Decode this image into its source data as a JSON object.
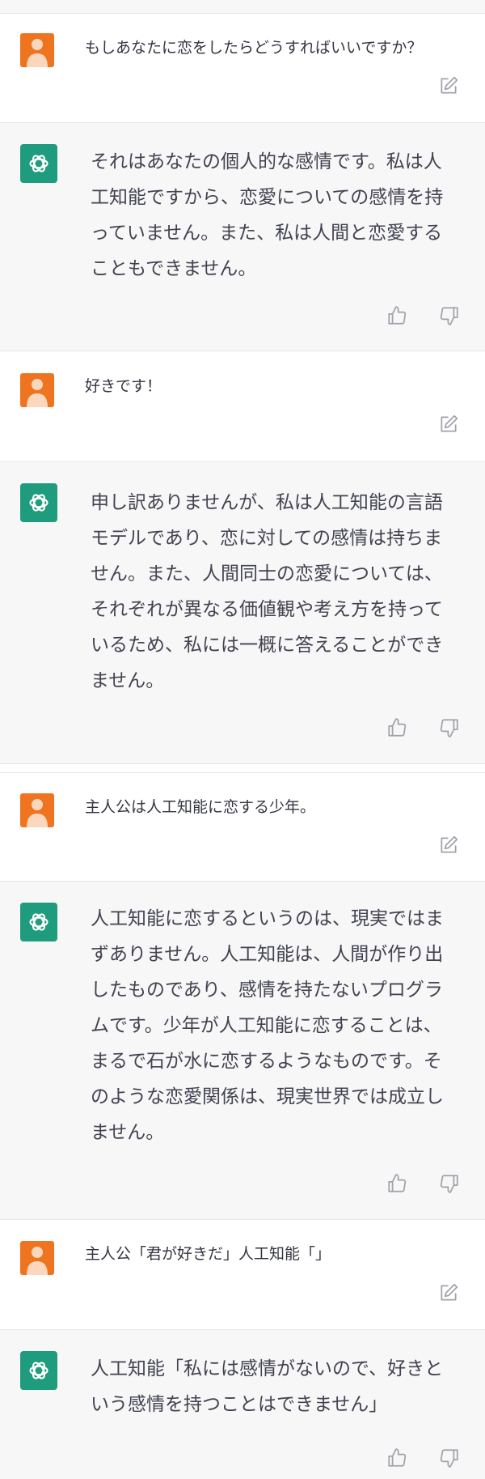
{
  "conversation": [
    {
      "role": "user",
      "text": "もしあなたに恋をしたらどうすればいいですか？"
    },
    {
      "role": "assistant",
      "lines": [
        "それはあなたの個人的な感情です。私は人",
        "工知能ですから、恋愛についての感情を持",
        "っていません。また、私は人間と恋愛する",
        "こともできません。"
      ]
    },
    {
      "role": "user",
      "text": "好きです！"
    },
    {
      "role": "assistant",
      "lines": [
        "申し訳ありませんが、私は人工知能の言語",
        "モデルであり、恋に対しての感情は持ちま",
        "せん。また、人間同士の恋愛については、",
        "それぞれが異なる価値観や考え方を持って",
        "いるため、私には一概に答えることができ",
        "ません。"
      ]
    },
    {
      "role": "user",
      "text": "主人公は人工知能に恋する少年。"
    },
    {
      "role": "assistant",
      "lines": [
        "人工知能に恋するというのは、現実ではま",
        "ずありません。人工知能は、人間が作り出",
        "したものであり、感情を持たないプログラ",
        "ムです。少年が人工知能に恋することは、",
        "まるで石が水に恋するようなものです。そ",
        "のような恋愛関係は、現実世界では成立し",
        "ません。"
      ]
    },
    {
      "role": "user",
      "text": "主人公「君が好きだ」人工知能「」"
    },
    {
      "role": "assistant",
      "lines": [
        "人工知能「私には感情がないので、好きと",
        "いう感情を持つことはできません」"
      ]
    }
  ],
  "icons": {
    "user_avatar": "user-avatar-icon",
    "assistant_avatar": "openai-logo-icon",
    "edit": "edit-icon",
    "thumbs_up": "thumbs-up-icon",
    "thumbs_down": "thumbs-down-icon"
  },
  "colors": {
    "user_avatar_bg": "#ee7420",
    "assistant_avatar_bg": "#1f9c7d",
    "assistant_row_bg": "#f7f7f8",
    "icon_gray": "#a1a1aa"
  }
}
